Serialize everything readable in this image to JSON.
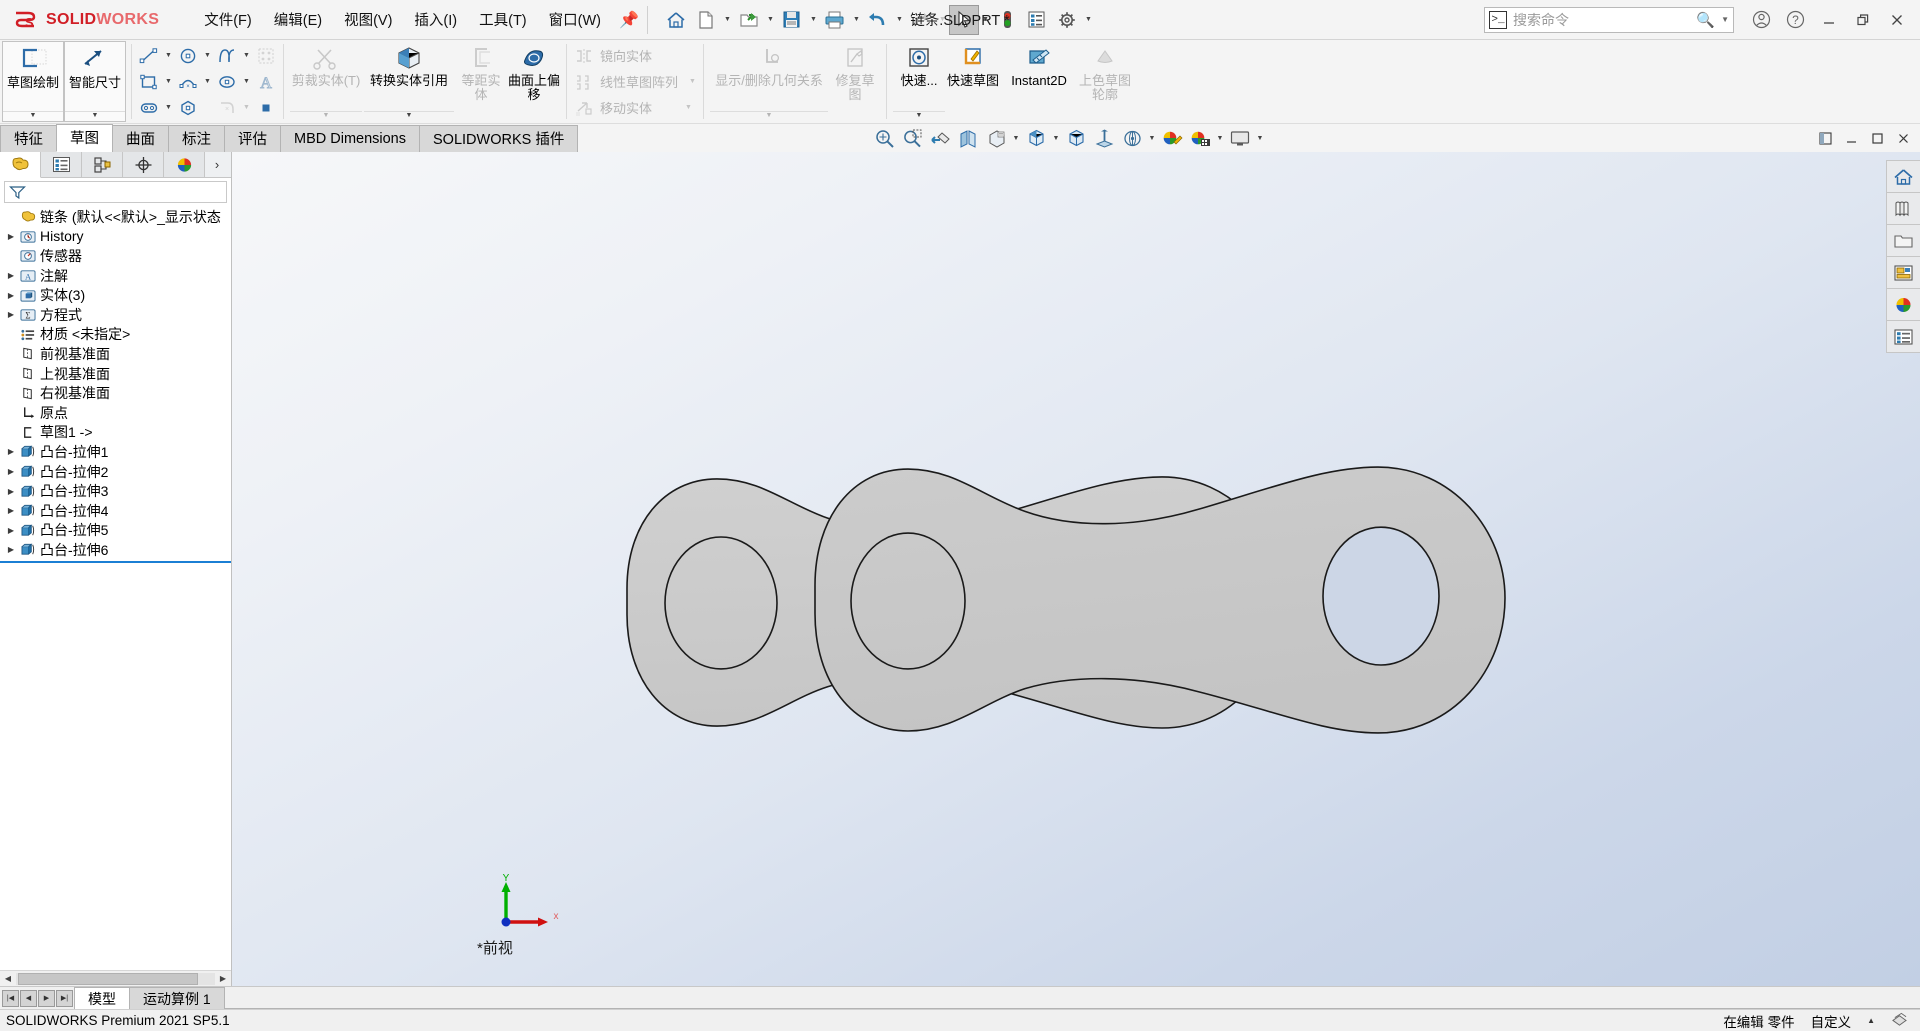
{
  "app": {
    "brand_ds": "ƏS",
    "brand_bold": "SOLID",
    "brand_light": "WORKS",
    "document_title": "链条.SLDPRT *",
    "version_status": "SOLIDWORKS Premium 2021 SP5.1",
    "accent_color": "#d11e26",
    "selection_color": "#1b7fd4"
  },
  "menubar": {
    "items": [
      {
        "label": "文件(F)",
        "name": "menu-file"
      },
      {
        "label": "编辑(E)",
        "name": "menu-edit"
      },
      {
        "label": "视图(V)",
        "name": "menu-view"
      },
      {
        "label": "插入(I)",
        "name": "menu-insert"
      },
      {
        "label": "工具(T)",
        "name": "menu-tools"
      },
      {
        "label": "窗口(W)",
        "name": "menu-window"
      }
    ],
    "pin_icon": "pin-icon"
  },
  "quick_access": [
    {
      "name": "home-icon",
      "has_arrow": false
    },
    {
      "name": "new-document-icon",
      "has_arrow": true
    },
    {
      "name": "open-folder-icon",
      "has_arrow": true
    },
    {
      "name": "save-icon",
      "has_arrow": true
    },
    {
      "name": "print-icon",
      "has_arrow": true
    },
    {
      "name": "undo-icon",
      "has_arrow": true
    },
    {
      "name": "redo-icon",
      "has_arrow": true
    },
    {
      "name": "select-cursor-icon",
      "has_arrow": true
    },
    {
      "name": "rebuild-traffic-light-icon",
      "has_arrow": false
    },
    {
      "name": "options-list-icon",
      "has_arrow": false
    },
    {
      "name": "settings-gear-icon",
      "has_arrow": true
    }
  ],
  "search": {
    "placeholder": "搜索命令",
    "prompt_icon": "command-prompt-icon",
    "magnifier_icon": "search-icon",
    "dropdown_icon": "chevron-down-icon"
  },
  "window_controls": {
    "account": "user-account-icon",
    "help": "help-icon",
    "minimize": "minimize-icon",
    "restore": "restore-icon",
    "close": "close-icon"
  },
  "ribbon": {
    "groups": [
      {
        "name": "sketch-primary",
        "big_buttons": [
          {
            "label": "草图绘制",
            "name": "sketch-button",
            "icon": "sketch-icon",
            "boxed": true,
            "disabled": false,
            "dropdown": true
          },
          {
            "label": "智能尺寸",
            "name": "smart-dimension-button",
            "icon": "smart-dimension-icon",
            "boxed": true,
            "disabled": false,
            "dropdown": true
          }
        ]
      },
      {
        "name": "sketch-entities",
        "small_rows": [
          [
            {
              "icon": "line-icon",
              "name": "line-tool",
              "arrow": true,
              "disabled": false
            },
            {
              "icon": "circle-icon",
              "name": "circle-tool",
              "arrow": true,
              "disabled": false
            },
            {
              "icon": "spline-icon",
              "name": "spline-tool",
              "arrow": true,
              "disabled": false
            },
            {
              "icon": "sketch-pattern-icon",
              "name": "sketch-pattern-tool",
              "arrow": false,
              "disabled": true
            }
          ],
          [
            {
              "icon": "rectangle-icon",
              "name": "rectangle-tool",
              "arrow": true,
              "disabled": false
            },
            {
              "icon": "arc-icon",
              "name": "arc-tool",
              "arrow": true,
              "disabled": false
            },
            {
              "icon": "ellipse-icon",
              "name": "ellipse-tool",
              "arrow": true,
              "disabled": false
            },
            {
              "icon": "text-icon",
              "name": "text-tool",
              "arrow": false,
              "disabled": false
            }
          ],
          [
            {
              "icon": "slot-icon",
              "name": "slot-tool",
              "arrow": true,
              "disabled": false
            },
            {
              "icon": "polygon-icon",
              "name": "polygon-tool",
              "arrow": false,
              "disabled": false
            },
            {
              "icon": "fillet-icon",
              "name": "sketch-fillet-tool",
              "arrow": true,
              "disabled": true
            },
            {
              "icon": "point-icon",
              "name": "point-tool",
              "arrow": false,
              "disabled": false
            }
          ]
        ]
      },
      {
        "name": "sketch-modify",
        "big_buttons": [
          {
            "label": "剪裁实体(T)",
            "name": "trim-entities-button",
            "icon": "trim-icon",
            "boxed": false,
            "disabled": true,
            "dropdown": true
          },
          {
            "label": "转换实体引用",
            "name": "convert-entities-button",
            "icon": "convert-entities-icon",
            "boxed": false,
            "disabled": false,
            "dropdown": true
          },
          {
            "label": "等距实体",
            "name": "offset-entities-button",
            "icon": "offset-icon",
            "boxed": false,
            "disabled": true,
            "dropdown": false
          },
          {
            "label": "曲面上偏移",
            "name": "offset-on-surface-button",
            "icon": "offset-surface-icon",
            "boxed": false,
            "disabled": false,
            "dropdown": false
          }
        ]
      },
      {
        "name": "sketch-pattern-group",
        "small_rows": [
          [
            {
              "icon": "mirror-icon",
              "name": "mirror-entities-tool",
              "arrow": false,
              "disabled": true,
              "label": "镜向实体"
            }
          ],
          [
            {
              "icon": "linear-pattern-icon",
              "name": "linear-sketch-pattern-tool",
              "arrow": true,
              "disabled": true,
              "label": "线性草图阵列"
            }
          ],
          [
            {
              "icon": "move-entities-icon",
              "name": "move-entities-tool",
              "arrow": true,
              "disabled": true,
              "label": "移动实体"
            }
          ]
        ]
      },
      {
        "name": "sketch-relations",
        "big_buttons": [
          {
            "label": "显示/删除几何关系",
            "name": "display-delete-relations-button",
            "icon": "relations-icon",
            "boxed": false,
            "disabled": true,
            "dropdown": true
          },
          {
            "label": "修复草图",
            "name": "repair-sketch-button",
            "icon": "repair-sketch-icon",
            "boxed": false,
            "disabled": true,
            "dropdown": false
          }
        ]
      },
      {
        "name": "sketch-quick",
        "big_buttons": [
          {
            "label": "快速...",
            "name": "quick-snaps-button",
            "icon": "quick-snaps-icon",
            "boxed": false,
            "disabled": false,
            "dropdown": true
          },
          {
            "label": "快速草图",
            "name": "rapid-sketch-button",
            "icon": "rapid-sketch-icon",
            "boxed": false,
            "disabled": false,
            "dropdown": false
          },
          {
            "label": "Instant2D",
            "name": "instant2d-button",
            "icon": "instant2d-icon",
            "boxed": false,
            "disabled": false,
            "dropdown": false
          },
          {
            "label": "上色草图轮廓",
            "name": "shaded-sketch-contours-button",
            "icon": "shaded-contour-icon",
            "boxed": false,
            "disabled": true,
            "dropdown": false
          }
        ]
      }
    ]
  },
  "tabs": {
    "items": [
      {
        "label": "特征",
        "name": "tab-features",
        "active": false
      },
      {
        "label": "草图",
        "name": "tab-sketch",
        "active": true
      },
      {
        "label": "曲面",
        "name": "tab-surfaces",
        "active": false
      },
      {
        "label": "标注",
        "name": "tab-markup",
        "active": false
      },
      {
        "label": "评估",
        "name": "tab-evaluate",
        "active": false
      },
      {
        "label": "MBD Dimensions",
        "name": "tab-mbd-dimensions",
        "active": false
      },
      {
        "label": "SOLIDWORKS 插件",
        "name": "tab-solidworks-addins",
        "active": false
      }
    ]
  },
  "view_toolbar": [
    {
      "name": "zoom-to-fit-icon",
      "arrow": false
    },
    {
      "name": "zoom-to-area-icon",
      "arrow": false
    },
    {
      "name": "previous-view-icon",
      "arrow": false
    },
    {
      "name": "section-view-icon",
      "arrow": false
    },
    {
      "name": "view-orientation-icon",
      "arrow": true
    },
    {
      "name": "display-style-icon",
      "arrow": true
    },
    {
      "name": "hide-show-items-icon",
      "arrow": false
    },
    {
      "name": "edit-appearance-icon",
      "arrow": false
    },
    {
      "name": "apply-scene-icon",
      "arrow": true
    },
    {
      "name": "view-settings-icon",
      "arrow": true
    },
    {
      "name": "appearances-icon",
      "arrow": true
    },
    {
      "name": "display-monitor-icon",
      "arrow": true
    }
  ],
  "doc_window_controls": {
    "restore_panel": "restore-panel-icon",
    "minimize": "minimize-icon",
    "maximize": "maximize-icon",
    "close": "close-icon"
  },
  "tree_panel": {
    "tabs": [
      {
        "name": "feature-manager-tab",
        "icon": "feature-tree-icon",
        "active": true
      },
      {
        "name": "property-manager-tab",
        "icon": "property-list-icon",
        "active": false
      },
      {
        "name": "configuration-manager-tab",
        "icon": "configuration-icon",
        "active": false
      },
      {
        "name": "dimxpert-manager-tab",
        "icon": "dimxpert-icon",
        "active": false
      },
      {
        "name": "display-manager-tab",
        "icon": "display-sphere-icon",
        "active": false
      }
    ],
    "more_icon": "chevron-right-icon",
    "filter_icon": "filter-icon",
    "root": {
      "label": "链条 (默认<<默认>_显示状态",
      "icon": "part-icon"
    },
    "nodes": [
      {
        "label": "History",
        "icon": "history-icon",
        "expandable": true,
        "indent": 1
      },
      {
        "label": "传感器",
        "icon": "sensors-icon",
        "expandable": false,
        "indent": 1
      },
      {
        "label": "注解",
        "icon": "annotations-icon",
        "expandable": true,
        "indent": 1
      },
      {
        "label": "实体(3)",
        "icon": "solid-bodies-icon",
        "expandable": true,
        "indent": 1
      },
      {
        "label": "方程式",
        "icon": "equations-icon",
        "expandable": true,
        "indent": 1
      },
      {
        "label": "材质 <未指定>",
        "icon": "material-icon",
        "expandable": false,
        "indent": 1
      },
      {
        "label": "前视基准面",
        "icon": "plane-icon",
        "expandable": false,
        "indent": 1
      },
      {
        "label": "上视基准面",
        "icon": "plane-icon",
        "expandable": false,
        "indent": 1
      },
      {
        "label": "右视基准面",
        "icon": "plane-icon",
        "expandable": false,
        "indent": 1
      },
      {
        "label": "原点",
        "icon": "origin-icon",
        "expandable": false,
        "indent": 1
      },
      {
        "label": "草图1 ->",
        "icon": "sketch-node-icon",
        "expandable": false,
        "indent": 1
      },
      {
        "label": "凸台-拉伸1",
        "icon": "boss-extrude-icon",
        "expandable": true,
        "indent": 1
      },
      {
        "label": "凸台-拉伸2",
        "icon": "boss-extrude-icon",
        "expandable": true,
        "indent": 1
      },
      {
        "label": "凸台-拉伸3",
        "icon": "boss-extrude-icon",
        "expandable": true,
        "indent": 1
      },
      {
        "label": "凸台-拉伸4",
        "icon": "boss-extrude-icon",
        "expandable": true,
        "indent": 1
      },
      {
        "label": "凸台-拉伸5",
        "icon": "boss-extrude-icon",
        "expandable": true,
        "indent": 1
      },
      {
        "label": "凸台-拉伸6",
        "icon": "boss-extrude-icon",
        "expandable": true,
        "indent": 1
      }
    ]
  },
  "right_toolbar": [
    {
      "name": "view-home-icon"
    },
    {
      "name": "appearances-library-icon"
    },
    {
      "name": "design-library-icon"
    },
    {
      "name": "file-explorer-icon"
    },
    {
      "name": "view-palette-icon"
    },
    {
      "name": "appearances-scenes-icon"
    },
    {
      "name": "custom-properties-icon"
    }
  ],
  "graphics": {
    "view_label": "*前视",
    "triad": {
      "x_label": "x",
      "y_label": "Y",
      "x_color": "#e02020",
      "y_color": "#00b000",
      "origin_color": "#1030c0"
    },
    "model_fill": "#c8c8c8",
    "model_edge": "#1a1a1a"
  },
  "bottom": {
    "nav_buttons": [
      "first-icon",
      "prev-icon",
      "next-icon",
      "last-icon"
    ],
    "tabs": [
      {
        "label": "模型",
        "name": "bottom-tab-model",
        "active": true
      },
      {
        "label": "运动算例 1",
        "name": "bottom-tab-motion-study",
        "active": false
      }
    ]
  },
  "status": {
    "left": "SOLIDWORKS Premium 2021 SP5.1",
    "editing": "在编辑 零件",
    "custom": "自定义",
    "arrow_icon": "chevron-up-icon",
    "overlay_icon": "overlay-icon"
  }
}
